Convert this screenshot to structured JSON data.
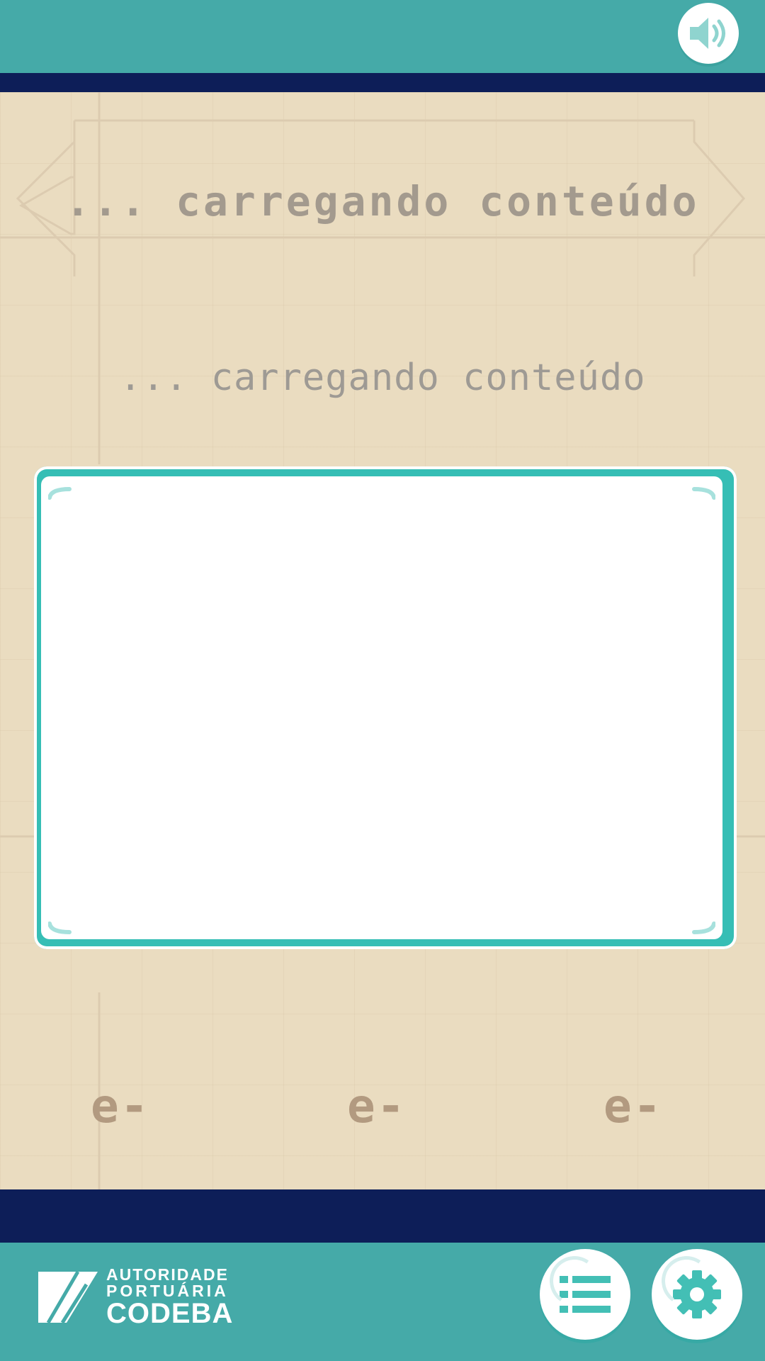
{
  "header": {
    "sound_button_label": "sound-on"
  },
  "main": {
    "title": "... carregando conteúdo",
    "subtitle": "... carregando conteúdo",
    "counters": [
      {
        "value": "e-"
      },
      {
        "value": "e-"
      },
      {
        "value": "e-"
      }
    ]
  },
  "footer": {
    "logo": {
      "line1": "AUTORIDADE",
      "line2": "PORTUÁRIA",
      "line3": "CODEBA"
    },
    "menu_button_icon": "list-icon",
    "settings_button_icon": "gear-icon"
  },
  "colors": {
    "bar": "#45aaa8",
    "stripe": "#0d1e58",
    "background": "#eadcc0",
    "card_border": "#36beb5",
    "text_muted": "#a39a8e",
    "counter_text": "#b29a80"
  }
}
